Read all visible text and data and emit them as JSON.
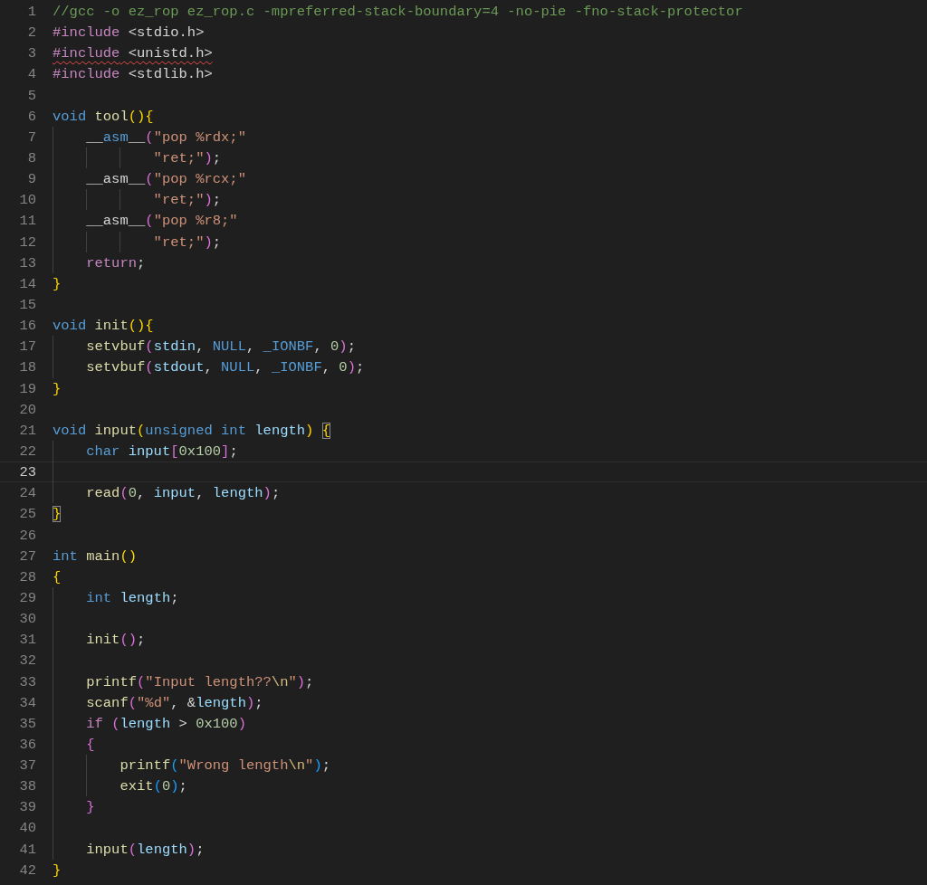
{
  "editor": {
    "lines": [
      {
        "number": "1",
        "current": false,
        "error": false,
        "tokens": [
          {
            "text": "//gcc -o ez_rop ez_rop.c -mpreferred-stack-boundary=4 -no-pie -fno-stack-protector",
            "kind": "comment"
          }
        ]
      },
      {
        "number": "2",
        "current": false,
        "error": false,
        "tokens": [
          {
            "text": "#include",
            "kind": "preproc"
          },
          {
            "text": " <stdio.h>",
            "kind": "plain"
          }
        ]
      },
      {
        "number": "3",
        "current": false,
        "error": true,
        "tokens": [
          {
            "text": "#include",
            "kind": "preproc"
          },
          {
            "text": " <unistd.h>",
            "kind": "plain"
          }
        ]
      },
      {
        "number": "4",
        "current": false,
        "error": false,
        "tokens": [
          {
            "text": "#include",
            "kind": "preproc"
          },
          {
            "text": " <stdlib.h>",
            "kind": "plain"
          }
        ]
      },
      {
        "number": "5",
        "current": false
      },
      {
        "number": "6",
        "current": false,
        "error": false,
        "tokens": [
          {
            "text": "void ",
            "kind": "type"
          },
          {
            "text": "tool",
            "kind": "function"
          },
          {
            "text": "()",
            "kind": "bracket1"
          },
          {
            "text": "{",
            "kind": "bracket1"
          }
        ]
      },
      {
        "number": "7",
        "current": false,
        "error": false,
        "tokens": [
          {
            "text": "    __",
            "kind": "plain"
          },
          {
            "text": "asm",
            "kind": "type"
          },
          {
            "text": "__",
            "kind": "plain"
          },
          {
            "text": "(",
            "kind": "bracket2"
          },
          {
            "text": "\"pop %rdx;\"",
            "kind": "string"
          }
        ]
      },
      {
        "number": "8",
        "current": false,
        "error": false,
        "tokens": [
          {
            "text": "            \"ret;\"",
            "kind": "string"
          },
          {
            "text": ")",
            "kind": "bracket2"
          },
          {
            "text": ";",
            "kind": "plain"
          }
        ]
      },
      {
        "number": "9",
        "current": false,
        "error": false,
        "tokens": [
          {
            "text": "    __asm__",
            "kind": "plain"
          },
          {
            "text": "(",
            "kind": "bracket2"
          },
          {
            "text": "\"pop %rcx;\"",
            "kind": "string"
          }
        ]
      },
      {
        "number": "10",
        "current": false,
        "error": false,
        "tokens": [
          {
            "text": "            \"ret;\"",
            "kind": "string"
          },
          {
            "text": ")",
            "kind": "bracket2"
          },
          {
            "text": ";",
            "kind": "plain"
          }
        ]
      },
      {
        "number": "11",
        "current": false,
        "error": false,
        "tokens": [
          {
            "text": "    __asm__",
            "kind": "plain"
          },
          {
            "text": "(",
            "kind": "bracket2"
          },
          {
            "text": "\"pop %r8;\"",
            "kind": "string"
          }
        ]
      },
      {
        "number": "12",
        "current": false,
        "error": false,
        "tokens": [
          {
            "text": "            \"ret;\"",
            "kind": "string"
          },
          {
            "text": ")",
            "kind": "bracket2"
          },
          {
            "text": ";",
            "kind": "plain"
          }
        ]
      },
      {
        "number": "13",
        "current": false,
        "error": false,
        "tokens": [
          {
            "text": "    return",
            "kind": "control"
          },
          {
            "text": ";",
            "kind": "plain"
          }
        ]
      },
      {
        "number": "14",
        "current": false,
        "error": false,
        "tokens": [
          {
            "text": "}",
            "kind": "bracket1"
          }
        ]
      },
      {
        "number": "15",
        "current": false
      },
      {
        "number": "16",
        "current": false,
        "error": false,
        "tokens": [
          {
            "text": "void ",
            "kind": "type"
          },
          {
            "text": "init",
            "kind": "function"
          },
          {
            "text": "()",
            "kind": "bracket1"
          },
          {
            "text": "{",
            "kind": "bracket1"
          }
        ]
      },
      {
        "number": "17",
        "current": false,
        "error": false,
        "tokens": [
          {
            "text": "    setvbuf",
            "kind": "function"
          },
          {
            "text": "(",
            "kind": "bracket2"
          },
          {
            "text": "stdin",
            "kind": "variable"
          },
          {
            "text": ", ",
            "kind": "plain"
          },
          {
            "text": "NULL",
            "kind": "type"
          },
          {
            "text": ", ",
            "kind": "plain"
          },
          {
            "text": "_IONBF",
            "kind": "type"
          },
          {
            "text": ", ",
            "kind": "plain"
          },
          {
            "text": "0",
            "kind": "number"
          },
          {
            "text": ")",
            "kind": "bracket2"
          },
          {
            "text": ";",
            "kind": "plain"
          }
        ]
      },
      {
        "number": "18",
        "current": false,
        "error": false,
        "tokens": [
          {
            "text": "    setvbuf",
            "kind": "function"
          },
          {
            "text": "(",
            "kind": "bracket2"
          },
          {
            "text": "stdout",
            "kind": "variable"
          },
          {
            "text": ", ",
            "kind": "plain"
          },
          {
            "text": "NULL",
            "kind": "type"
          },
          {
            "text": ", ",
            "kind": "plain"
          },
          {
            "text": "_IONBF",
            "kind": "type"
          },
          {
            "text": ", ",
            "kind": "plain"
          },
          {
            "text": "0",
            "kind": "number"
          },
          {
            "text": ")",
            "kind": "bracket2"
          },
          {
            "text": ";",
            "kind": "plain"
          }
        ]
      },
      {
        "number": "19",
        "current": false,
        "error": false,
        "tokens": [
          {
            "text": "}",
            "kind": "bracket1"
          }
        ]
      },
      {
        "number": "20",
        "current": false
      },
      {
        "number": "21",
        "current": false,
        "error": false,
        "tokens": [
          {
            "text": "void ",
            "kind": "type"
          },
          {
            "text": "input",
            "kind": "function"
          },
          {
            "text": "(",
            "kind": "bracket1"
          },
          {
            "text": "unsigned ",
            "kind": "type"
          },
          {
            "text": "int ",
            "kind": "type"
          },
          {
            "text": "length",
            "kind": "variable"
          },
          {
            "text": ") ",
            "kind": "bracket1"
          },
          {
            "text": "{",
            "kind": "bracket1-matched"
          }
        ]
      },
      {
        "number": "22",
        "current": false,
        "error": false,
        "tokens": [
          {
            "text": "    char ",
            "kind": "type"
          },
          {
            "text": "input",
            "kind": "variable"
          },
          {
            "text": "[",
            "kind": "bracket2"
          },
          {
            "text": "0x100",
            "kind": "number"
          },
          {
            "text": "]",
            "kind": "bracket2"
          },
          {
            "text": ";",
            "kind": "plain"
          }
        ]
      },
      {
        "number": "23",
        "current": true
      },
      {
        "number": "24",
        "current": false,
        "error": false,
        "tokens": [
          {
            "text": "    read",
            "kind": "function"
          },
          {
            "text": "(",
            "kind": "bracket2"
          },
          {
            "text": "0",
            "kind": "number"
          },
          {
            "text": ", ",
            "kind": "plain"
          },
          {
            "text": "input",
            "kind": "variable"
          },
          {
            "text": ", ",
            "kind": "plain"
          },
          {
            "text": "length",
            "kind": "variable"
          },
          {
            "text": ")",
            "kind": "bracket2"
          },
          {
            "text": ";",
            "kind": "plain"
          }
        ]
      },
      {
        "number": "25",
        "current": false,
        "error": false,
        "tokens": [
          {
            "text": "}",
            "kind": "bracket1-matched"
          }
        ]
      },
      {
        "number": "26",
        "current": false
      },
      {
        "number": "27",
        "current": false,
        "error": false,
        "tokens": [
          {
            "text": "int ",
            "kind": "type"
          },
          {
            "text": "main",
            "kind": "function"
          },
          {
            "text": "()",
            "kind": "bracket1"
          }
        ]
      },
      {
        "number": "28",
        "current": false,
        "error": false,
        "tokens": [
          {
            "text": "{",
            "kind": "bracket1"
          }
        ]
      },
      {
        "number": "29",
        "current": false,
        "error": false,
        "tokens": [
          {
            "text": "    int ",
            "kind": "type"
          },
          {
            "text": "length",
            "kind": "variable"
          },
          {
            "text": ";",
            "kind": "plain"
          }
        ]
      },
      {
        "number": "30",
        "current": false
      },
      {
        "number": "31",
        "current": false,
        "error": false,
        "tokens": [
          {
            "text": "    init",
            "kind": "function"
          },
          {
            "text": "()",
            "kind": "bracket2"
          },
          {
            "text": ";",
            "kind": "plain"
          }
        ]
      },
      {
        "number": "32",
        "current": false
      },
      {
        "number": "33",
        "current": false,
        "error": false,
        "tokens": [
          {
            "text": "    printf",
            "kind": "function"
          },
          {
            "text": "(",
            "kind": "bracket2"
          },
          {
            "text": "\"Input length??",
            "kind": "string"
          },
          {
            "text": "\\n",
            "kind": "escape"
          },
          {
            "text": "\"",
            "kind": "string"
          },
          {
            "text": ")",
            "kind": "bracket2"
          },
          {
            "text": ";",
            "kind": "plain"
          }
        ]
      },
      {
        "number": "34",
        "current": false,
        "error": false,
        "tokens": [
          {
            "text": "    scanf",
            "kind": "function"
          },
          {
            "text": "(",
            "kind": "bracket2"
          },
          {
            "text": "\"%d\"",
            "kind": "string"
          },
          {
            "text": ", &",
            "kind": "plain"
          },
          {
            "text": "length",
            "kind": "variable"
          },
          {
            "text": ")",
            "kind": "bracket2"
          },
          {
            "text": ";",
            "kind": "plain"
          }
        ]
      },
      {
        "number": "35",
        "current": false,
        "error": false,
        "tokens": [
          {
            "text": "    if ",
            "kind": "control"
          },
          {
            "text": "(",
            "kind": "bracket2"
          },
          {
            "text": "length",
            "kind": "variable"
          },
          {
            "text": " > ",
            "kind": "plain"
          },
          {
            "text": "0x100",
            "kind": "number"
          },
          {
            "text": ")",
            "kind": "bracket2"
          }
        ]
      },
      {
        "number": "36",
        "current": false,
        "error": false,
        "tokens": [
          {
            "text": "    {",
            "kind": "bracket2"
          }
        ]
      },
      {
        "number": "37",
        "current": false,
        "error": false,
        "tokens": [
          {
            "text": "        printf",
            "kind": "function"
          },
          {
            "text": "(",
            "kind": "bracket3"
          },
          {
            "text": "\"Wrong length",
            "kind": "string"
          },
          {
            "text": "\\n",
            "kind": "escape"
          },
          {
            "text": "\"",
            "kind": "string"
          },
          {
            "text": ")",
            "kind": "bracket3"
          },
          {
            "text": ";",
            "kind": "plain"
          }
        ]
      },
      {
        "number": "38",
        "current": false,
        "error": false,
        "tokens": [
          {
            "text": "        exit",
            "kind": "function"
          },
          {
            "text": "(",
            "kind": "bracket3"
          },
          {
            "text": "0",
            "kind": "number"
          },
          {
            "text": ")",
            "kind": "bracket3"
          },
          {
            "text": ";",
            "kind": "plain"
          }
        ]
      },
      {
        "number": "39",
        "current": false,
        "error": false,
        "tokens": [
          {
            "text": "    }",
            "kind": "bracket2"
          }
        ]
      },
      {
        "number": "40",
        "current": false
      },
      {
        "number": "41",
        "current": false,
        "error": false,
        "tokens": [
          {
            "text": "    input",
            "kind": "function"
          },
          {
            "text": "(",
            "kind": "bracket2"
          },
          {
            "text": "length",
            "kind": "variable"
          },
          {
            "text": ")",
            "kind": "bracket2"
          },
          {
            "text": ";",
            "kind": "plain"
          }
        ]
      },
      {
        "number": "42",
        "current": false,
        "error": false,
        "tokens": [
          {
            "text": "}",
            "kind": "bracket1"
          }
        ]
      }
    ]
  }
}
